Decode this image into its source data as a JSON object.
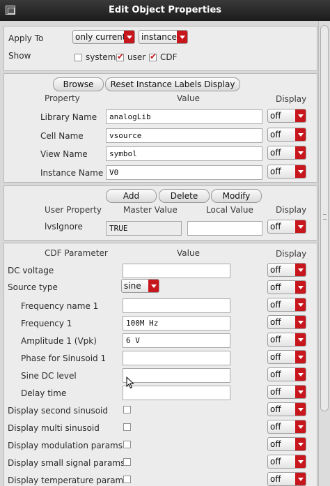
{
  "window": {
    "title": "Edit Object Properties"
  },
  "top": {
    "apply_to_label": "Apply To",
    "apply_to_value": "only current",
    "apply_scope_value": "instance",
    "show_label": "Show",
    "show_options": [
      {
        "label": "system",
        "checked": false
      },
      {
        "label": "user",
        "checked": true
      },
      {
        "label": "CDF",
        "checked": true
      }
    ]
  },
  "instance": {
    "browse_label": "Browse",
    "reset_label": "Reset Instance Labels Display",
    "headers": {
      "property": "Property",
      "value": "Value",
      "display": "Display"
    },
    "rows": [
      {
        "name": "Library Name",
        "value": "analogLib",
        "display": "off"
      },
      {
        "name": "Cell Name",
        "value": "vsource",
        "display": "off"
      },
      {
        "name": "View Name",
        "value": "symbol",
        "display": "off"
      },
      {
        "name": "Instance Name",
        "value": "V0",
        "display": "off"
      }
    ]
  },
  "user_props": {
    "add_label": "Add",
    "delete_label": "Delete",
    "modify_label": "Modify",
    "headers": {
      "user_property": "User Property",
      "master_value": "Master Value",
      "local_value": "Local Value",
      "display": "Display"
    },
    "rows": [
      {
        "name": "lvsIgnore",
        "master": "TRUE",
        "local": "",
        "display": "off"
      }
    ]
  },
  "cdf": {
    "headers": {
      "param": "CDF Parameter",
      "value": "Value",
      "display": "Display"
    },
    "rows": [
      {
        "name": "DC voltage",
        "kind": "text",
        "value": "",
        "display": "off"
      },
      {
        "name": "Source type",
        "kind": "select",
        "value": "sine",
        "display": "off"
      },
      {
        "name": "Frequency name 1",
        "kind": "text",
        "value": "",
        "display": "off"
      },
      {
        "name": "Frequency 1",
        "kind": "text",
        "value": "100M Hz",
        "display": "off"
      },
      {
        "name": "Amplitude 1 (Vpk)",
        "kind": "text",
        "value": "6 V",
        "display": "off"
      },
      {
        "name": "Phase for Sinusoid 1",
        "kind": "text",
        "value": "",
        "display": "off"
      },
      {
        "name": "Sine DC level",
        "kind": "text",
        "value": "",
        "display": "off"
      },
      {
        "name": "Delay time",
        "kind": "text",
        "value": "",
        "display": "off"
      },
      {
        "name": "Display second sinusoid",
        "kind": "checkbox",
        "checked": false,
        "display": "off"
      },
      {
        "name": "Display multi sinusoid",
        "kind": "checkbox",
        "checked": false,
        "display": "off"
      },
      {
        "name": "Display modulation params",
        "kind": "checkbox",
        "checked": false,
        "display": "off"
      },
      {
        "name": "Display small signal params",
        "kind": "checkbox",
        "checked": false,
        "display": "off"
      },
      {
        "name": "Display temperature params",
        "kind": "checkbox",
        "checked": false,
        "display": "off"
      }
    ]
  },
  "colors": {
    "titlebar": "#1c1c1c",
    "dropdown_arrow": "#c8161d",
    "panel": "#ececec"
  },
  "icons": {
    "window": "window-icon",
    "dropdown": "chevron-down-icon",
    "cursor": "mouse-pointer-icon"
  }
}
